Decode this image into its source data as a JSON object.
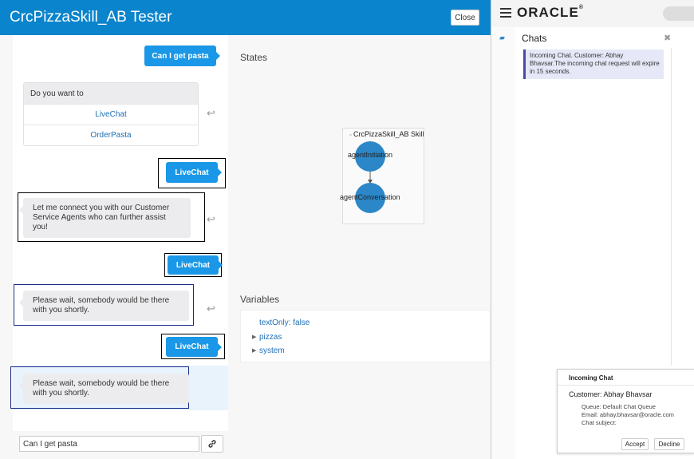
{
  "tester": {
    "title": "CrcPizzaSkill_AB Tester",
    "close_label": "Close",
    "messages": {
      "user1": "Can I get pasta",
      "bot_prompt": "Do you want to",
      "choices": [
        "LiveChat",
        "OrderPasta"
      ],
      "user2": "LiveChat",
      "bot_connect": "Let me connect you with our Customer Service Agents who can further assist you!",
      "user3": "LiveChat",
      "bot_wait1": "Please wait, somebody would be there with you shortly.",
      "user4": "LiveChat",
      "bot_wait2": "Please wait, somebody would be there with you shortly."
    },
    "input_value": "Can I get pasta"
  },
  "states": {
    "label": "States",
    "flow_title": "CrcPizzaSkill_AB Skill",
    "nodes": [
      "agentInitiation",
      "agentConversation"
    ]
  },
  "variables": {
    "label": "Variables",
    "items": [
      "textOnly: false",
      "pizzas",
      "system"
    ]
  },
  "oracle": {
    "logo": "ORACLE",
    "registered": "®",
    "chats_title": "Chats",
    "notification": "Incoming Chat. Customer: Abhay Bhavsar.The incoming chat request will expire in 15 seconds.",
    "dialog": {
      "title": "Incoming Chat",
      "customer": "Customer: Abhay Bhavsar",
      "queue": "Queue: Default Chat Queue",
      "email": "Email: abhay.bhavsar@oracle.com",
      "subject": "Chat subject:",
      "accept": "Accept",
      "decline": "Decline"
    }
  },
  "colors": {
    "header_blue": "#0a84cc",
    "user_bubble": "#1a97e6",
    "node_blue": "#2b87c8"
  }
}
